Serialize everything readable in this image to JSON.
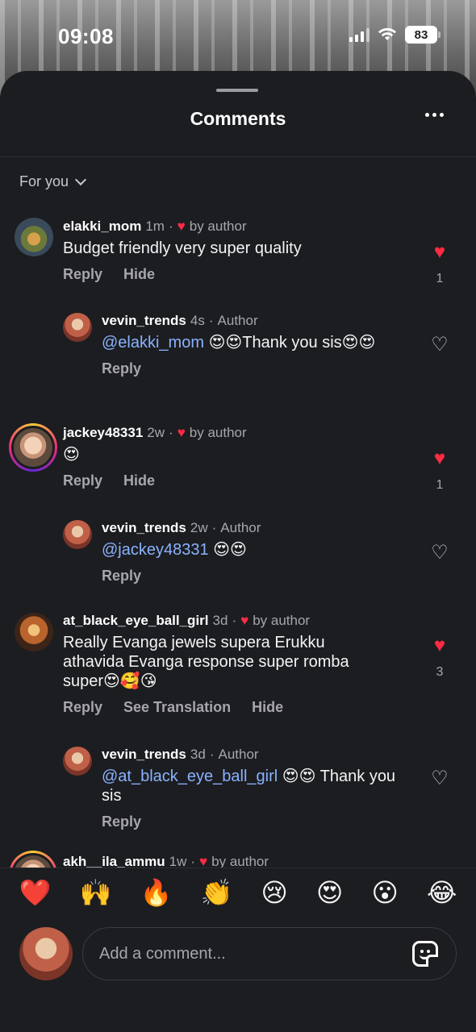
{
  "status_bar": {
    "time": "09:08",
    "battery": "83"
  },
  "sheet": {
    "title": "Comments",
    "filter_label": "For you"
  },
  "comments": [
    {
      "user": "elakki_mom",
      "time": "1m",
      "badge": "by author",
      "text": "Budget friendly very super  quality",
      "actions": [
        "Reply",
        "Hide"
      ],
      "liked": true,
      "likes": "1"
    },
    {
      "user": "vevin_trends",
      "time": "4s",
      "badge": "Author",
      "mention": "@elakki_mom",
      "text": " 😍😍Thank you sis😍😍",
      "actions": [
        "Reply"
      ],
      "liked": false
    },
    {
      "user": "jackey48331",
      "time": "2w",
      "badge": "by author",
      "text": "😍",
      "actions": [
        "Reply",
        "Hide"
      ],
      "liked": true,
      "likes": "1"
    },
    {
      "user": "vevin_trends",
      "time": "2w",
      "badge": "Author",
      "mention": "@jackey48331",
      "text": " 😍😍",
      "actions": [
        "Reply"
      ],
      "liked": false
    },
    {
      "user": "at_black_eye_ball_girl",
      "time": "3d",
      "badge": "by author",
      "text": "Really Evanga jewels supera Erukku athavida Evanga response super romba super😍🥰😘",
      "actions": [
        "Reply",
        "See Translation",
        "Hide"
      ],
      "liked": true,
      "likes": "3"
    },
    {
      "user": "vevin_trends",
      "time": "3d",
      "badge": "Author",
      "mention": "@at_black_eye_ball_girl",
      "text": " 😍😍 Thank you sis",
      "actions": [
        "Reply"
      ],
      "liked": false
    },
    {
      "user": "akh__ila_ammu",
      "time": "1w",
      "badge": "by author"
    }
  ],
  "emoji_bar": [
    "❤️",
    "🙌",
    "🔥",
    "👏",
    "😢",
    "😍",
    "😮",
    "😂"
  ],
  "composer": {
    "placeholder": "Add a comment..."
  },
  "icons": {
    "heart_filled": "heart-icon",
    "heart_outline": "heart-outline-icon",
    "more": "more-icon",
    "sticker": "sticker-icon"
  },
  "colors": {
    "like_red": "#ff2b45",
    "mention_blue": "#8ab2ff",
    "background": "#1c1d21"
  }
}
